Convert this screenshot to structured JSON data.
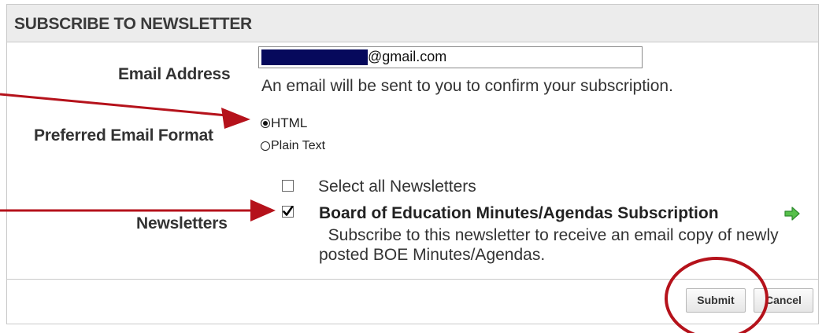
{
  "panel": {
    "title": "SUBSCRIBE TO NEWSLETTER"
  },
  "fields": {
    "email_label": "Email Address",
    "email_value_visible": "@gmail.com",
    "email_hint": "An email will be sent to you to confirm your subscription.",
    "format_label": "Preferred Email Format",
    "format_options": [
      {
        "label": "HTML",
        "selected": true
      },
      {
        "label": "Plain Text",
        "selected": false
      }
    ],
    "newsletters_label": "Newsletters",
    "select_all_label": "Select all Newsletters",
    "select_all_checked": false,
    "newsletter": {
      "title": "Board of Education Minutes/Agendas Subscription",
      "checked": true,
      "description": "Subscribe to this newsletter to receive an email copy of newly posted BOE Minutes/Agendas."
    }
  },
  "buttons": {
    "submit": "Submit",
    "cancel": "Cancel"
  },
  "colors": {
    "annotation": "#b5121b",
    "redaction": "#06095c",
    "arrow_icon": "#4caf50"
  },
  "icons": [
    "arrow-right-icon"
  ]
}
